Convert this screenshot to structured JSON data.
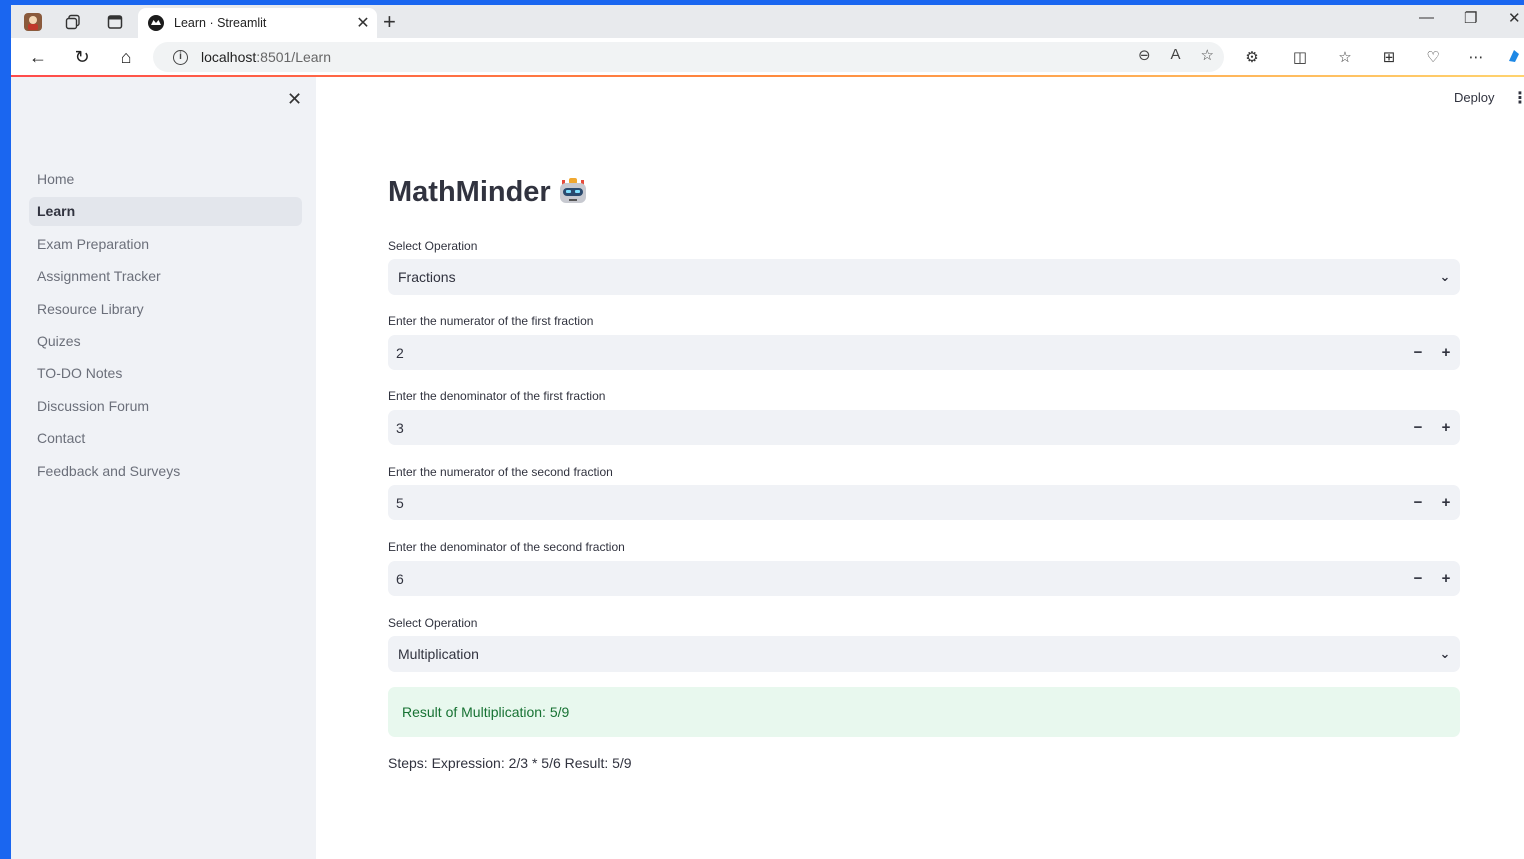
{
  "browser": {
    "tab_title": "Learn · Streamlit",
    "url_host": "localhost",
    "url_rest": ":8501/Learn"
  },
  "sidebar": {
    "items": [
      {
        "label": "Home"
      },
      {
        "label": "Learn"
      },
      {
        "label": "Exam Preparation"
      },
      {
        "label": "Assignment Tracker"
      },
      {
        "label": "Resource Library"
      },
      {
        "label": "Quizes"
      },
      {
        "label": "TO-DO Notes"
      },
      {
        "label": "Discussion Forum"
      },
      {
        "label": "Contact"
      },
      {
        "label": "Feedback and Surveys"
      }
    ],
    "active_index": 1
  },
  "header": {
    "deploy_label": "Deploy"
  },
  "main": {
    "title": "MathMinder",
    "select_operation_label": "Select Operation",
    "select_operation_value": "Fractions",
    "num1_label": "Enter the numerator of the first fraction",
    "num1_value": "2",
    "den1_label": "Enter the denominator of the first fraction",
    "den1_value": "3",
    "num2_label": "Enter the numerator of the second fraction",
    "num2_value": "5",
    "den2_label": "Enter the denominator of the second fraction",
    "den2_value": "6",
    "select_op2_label": "Select Operation",
    "select_op2_value": "Multiplication",
    "result_text": "Result of Multiplication: 5/9",
    "steps_text": "Steps: Expression: 2/3 * 5/6 Result: 5/9"
  }
}
